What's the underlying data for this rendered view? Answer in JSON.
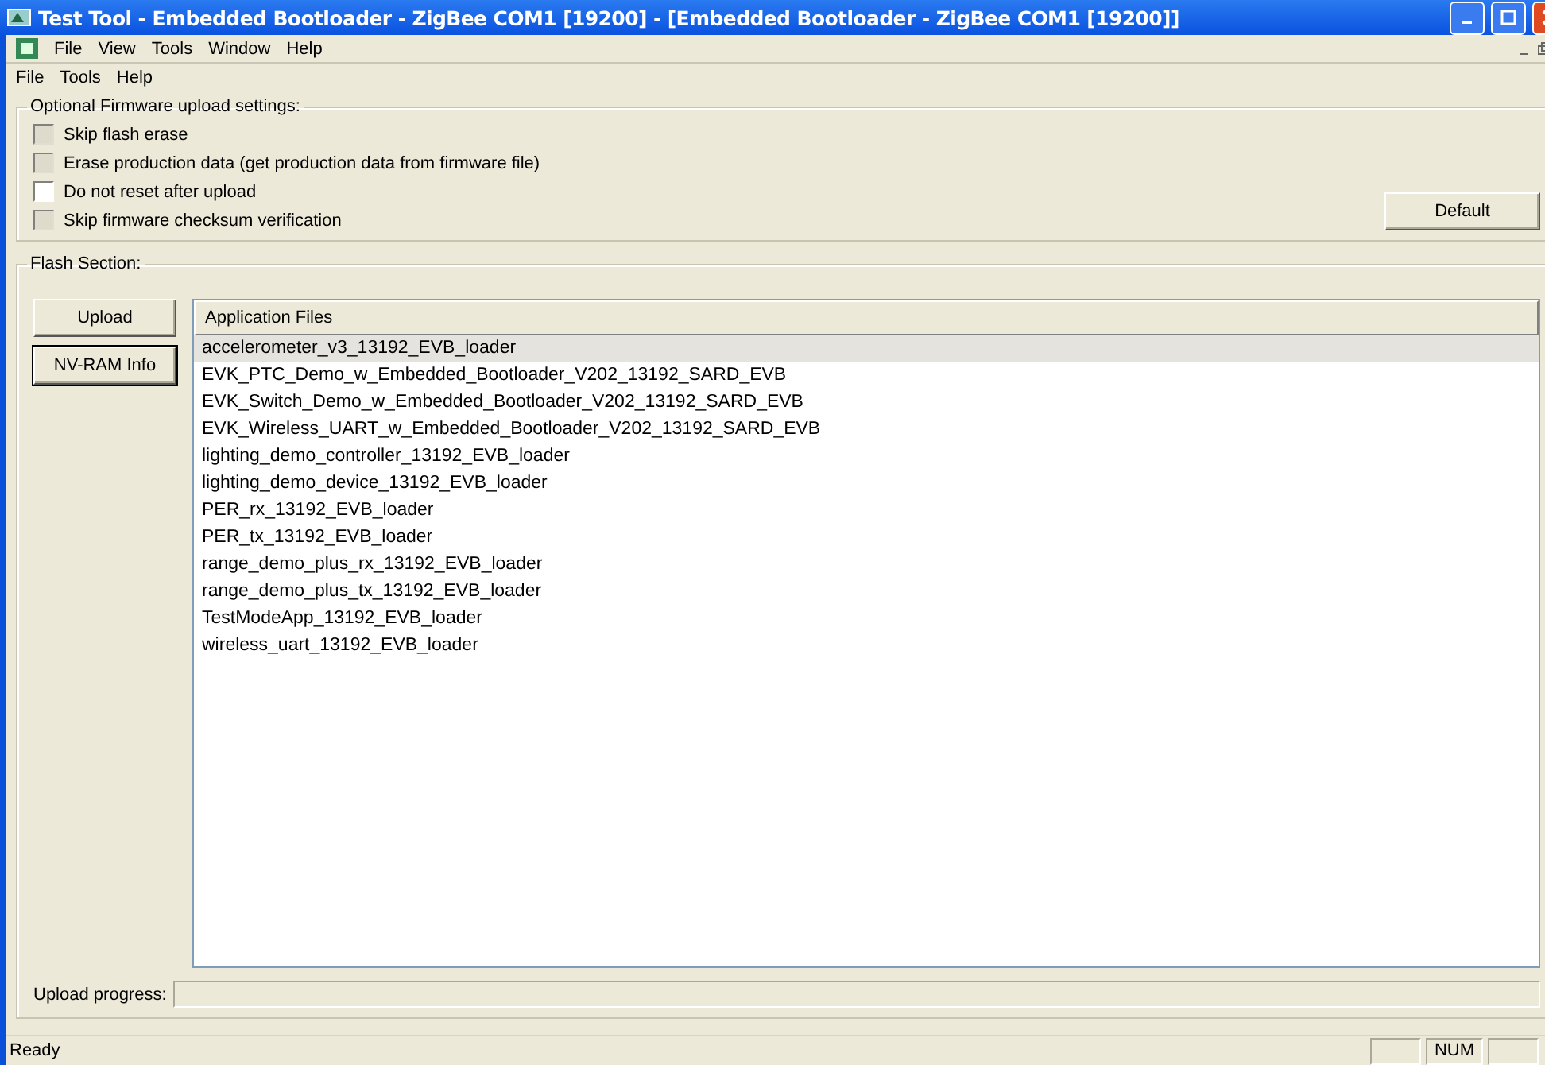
{
  "window": {
    "title": "Test Tool - Embedded Bootloader - ZigBee COM1 [19200] - [Embedded Bootloader - ZigBee COM1 [19200]]"
  },
  "app_menu": [
    "File",
    "View",
    "Tools",
    "Window",
    "Help"
  ],
  "doc_menu": [
    "File",
    "Tools",
    "Help"
  ],
  "options": {
    "title": "Optional Firmware upload settings:",
    "items": [
      {
        "label": "Skip flash erase",
        "checked": false,
        "disabled": true
      },
      {
        "label": "Erase production data (get production data from firmware file)",
        "checked": false,
        "disabled": true
      },
      {
        "label": "Do not reset after upload",
        "checked": false,
        "disabled": false
      },
      {
        "label": "Skip firmware checksum verification",
        "checked": false,
        "disabled": true
      }
    ],
    "default_button": "Default"
  },
  "flash": {
    "title": "Flash Section:",
    "buttons": [
      "Upload",
      "NV-RAM Info"
    ],
    "list": {
      "column": "Application Files",
      "rows": [
        {
          "name": "accelerometer_v3_13192_EVB_loader",
          "selected": true
        },
        {
          "name": "EVK_PTC_Demo_w_Embedded_Bootloader_V202_13192_SARD_EVB",
          "selected": false
        },
        {
          "name": "EVK_Switch_Demo_w_Embedded_Bootloader_V202_13192_SARD_EVB",
          "selected": false
        },
        {
          "name": "EVK_Wireless_UART_w_Embedded_Bootloader_V202_13192_SARD_EVB",
          "selected": false
        },
        {
          "name": "lighting_demo_controller_13192_EVB_loader",
          "selected": false
        },
        {
          "name": "lighting_demo_device_13192_EVB_loader",
          "selected": false
        },
        {
          "name": "PER_rx_13192_EVB_loader",
          "selected": false
        },
        {
          "name": "PER_tx_13192_EVB_loader",
          "selected": false
        },
        {
          "name": "range_demo_plus_rx_13192_EVB_loader",
          "selected": false
        },
        {
          "name": "range_demo_plus_tx_13192_EVB_loader",
          "selected": false
        },
        {
          "name": "TestModeApp_13192_EVB_loader",
          "selected": false
        },
        {
          "name": "wireless_uart_13192_EVB_loader",
          "selected": false
        }
      ]
    },
    "progress_label": "Upload progress:",
    "progress": {
      "level": 0
    }
  },
  "status_bar": {
    "text": "Ready",
    "indicators": [
      "NUM"
    ]
  }
}
